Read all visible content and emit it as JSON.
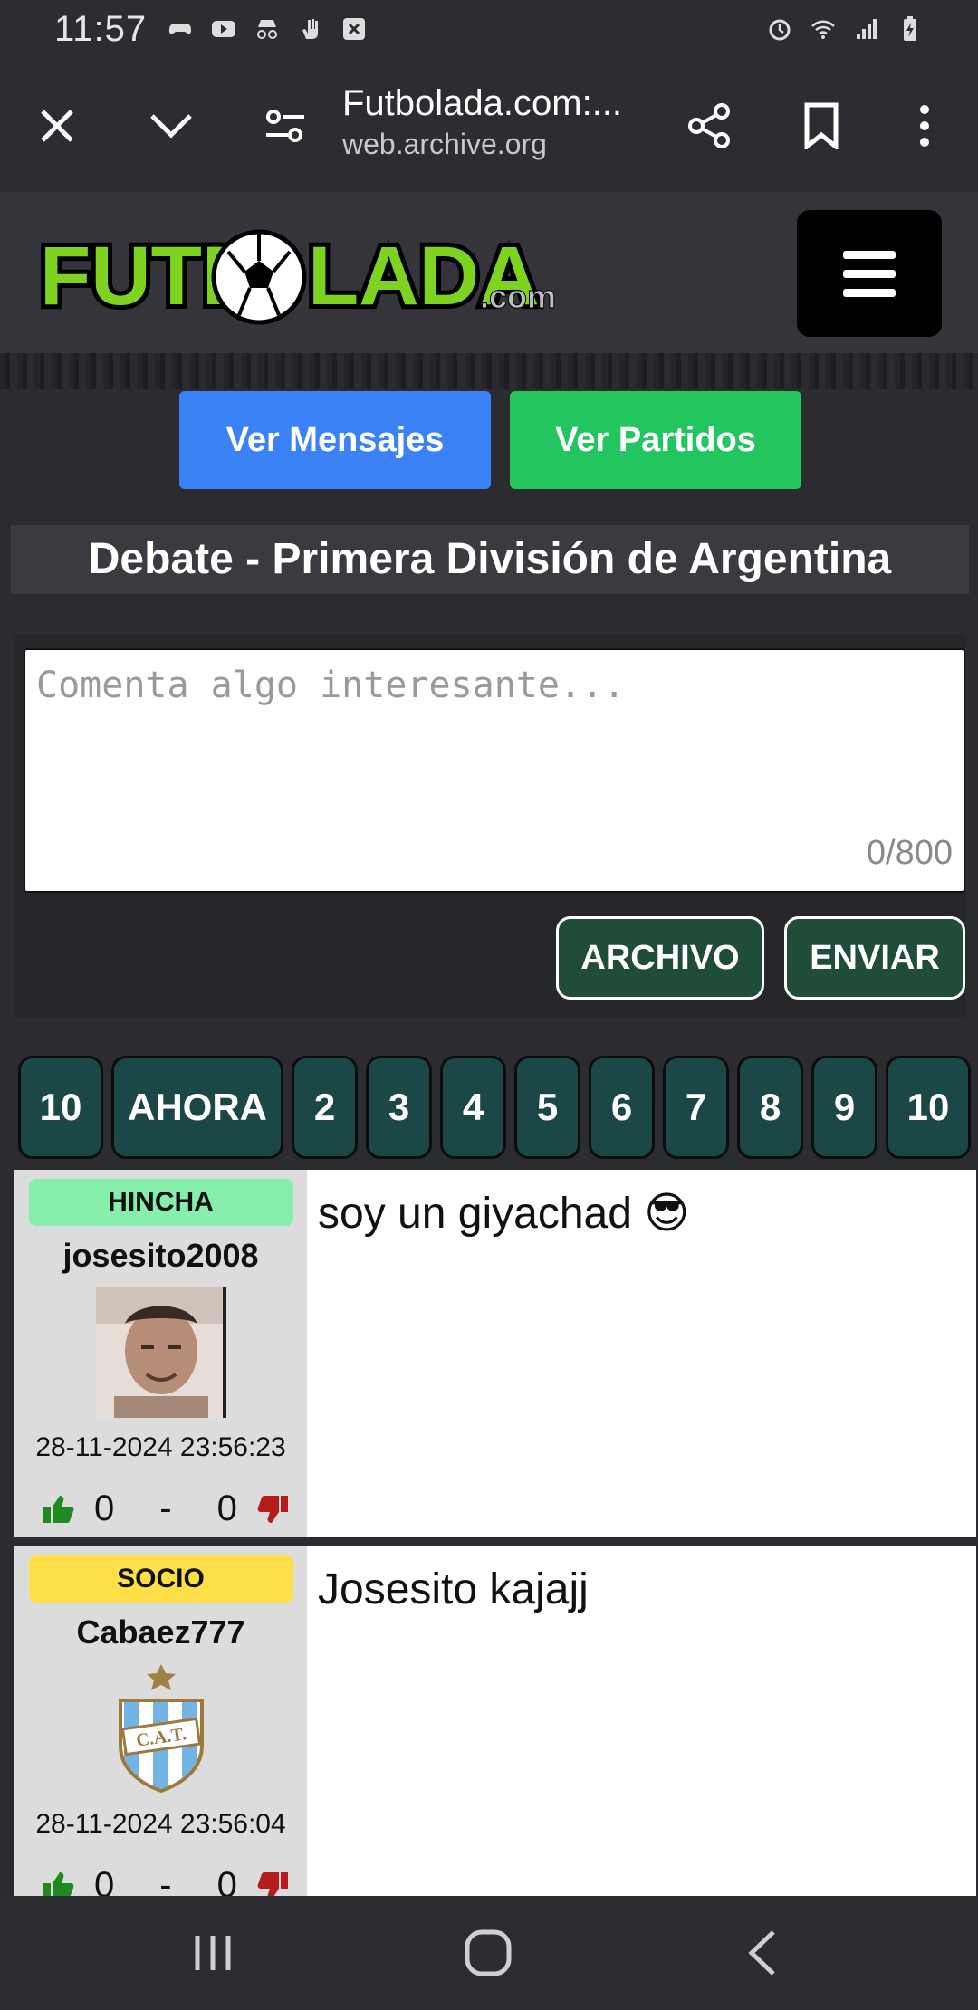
{
  "status_bar": {
    "time": "11:57"
  },
  "browser": {
    "page_title": "Futbolada.com:...",
    "domain": "web.archive.org"
  },
  "site": {
    "logo_text": "FUTBOLADA",
    "logo_suffix": ".com"
  },
  "buttons": {
    "ver_mensajes": "Ver Mensajes",
    "ver_partidos": "Ver Partidos"
  },
  "debate": {
    "title": "Debate - Primera División de Argentina"
  },
  "comment_form": {
    "placeholder": "Comenta algo interesante...",
    "char_count": "0/800",
    "archivo_label": "ARCHIVO",
    "enviar_label": "ENVIAR"
  },
  "pagination": [
    "10",
    "AHORA",
    "2",
    "3",
    "4",
    "5",
    "6",
    "7",
    "8",
    "9",
    "10"
  ],
  "posts": [
    {
      "role": "HINCHA",
      "role_color": "#86efac",
      "username": "josesito2008",
      "date": "28-11-2024 23:56:23",
      "likes": "0",
      "separator": "-",
      "dislikes": "0",
      "message": "soy un giyachad 😎"
    },
    {
      "role": "SOCIO",
      "role_color": "#fde047",
      "username": "Cabaez777",
      "date": "28-11-2024 23:56:04",
      "likes": "0",
      "separator": "-",
      "dislikes": "0",
      "message": "Josesito kajajj",
      "crest_text": "C.A.T."
    }
  ]
}
